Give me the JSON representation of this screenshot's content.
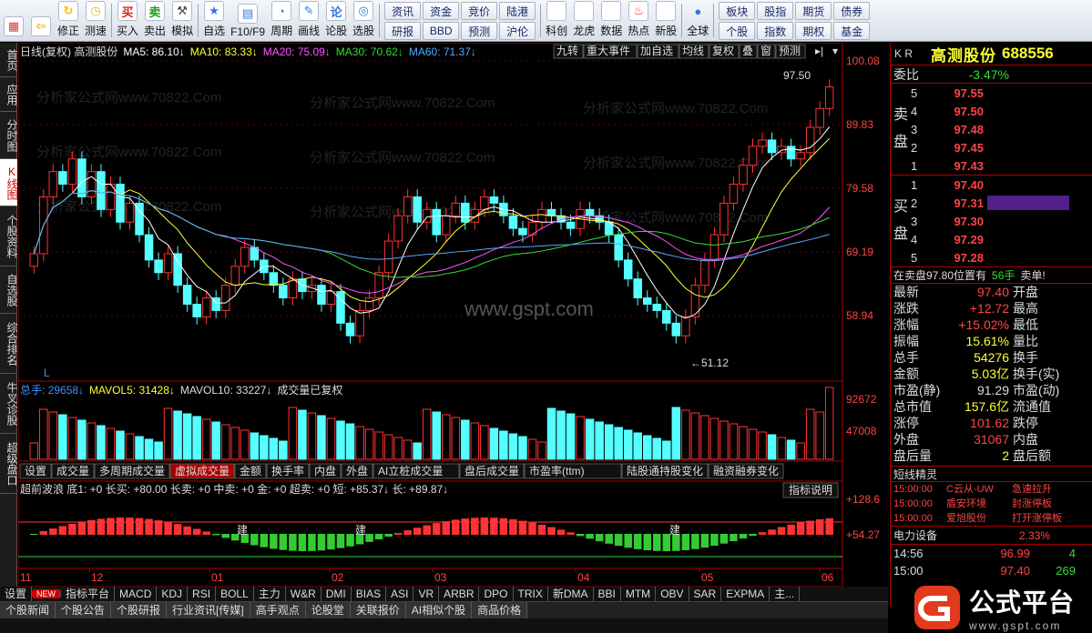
{
  "toolbar": {
    "left": [
      {
        "icon": "grid-icon",
        "label": ""
      },
      {
        "icon": "back-arrow-icon",
        "label": ""
      },
      {
        "icon": "repair-icon",
        "label": "修正"
      },
      {
        "icon": "speed-test-icon",
        "label": "测速"
      }
    ],
    "trade": [
      {
        "icon": "buy-icon",
        "label": "买入",
        "glyph": "买"
      },
      {
        "icon": "sell-icon",
        "label": "卖出",
        "glyph": "卖"
      },
      {
        "icon": "simulate-icon",
        "label": "模拟",
        "glyph": "⚒"
      }
    ],
    "tools": [
      {
        "icon": "star-icon",
        "label": "自选"
      },
      {
        "icon": "f10-icon",
        "label": "F10/F9"
      },
      {
        "icon": "period-icon",
        "label": "周期"
      },
      {
        "icon": "draw-icon",
        "label": "画线"
      },
      {
        "icon": "stock-forum-icon",
        "label": "论股"
      },
      {
        "icon": "stock-picker-icon",
        "label": "选股"
      }
    ],
    "grid1": [
      [
        "资讯",
        "研报"
      ],
      [
        "资金",
        "BBD"
      ],
      [
        "竞价",
        "预测"
      ],
      [
        "陆港",
        "沪伦"
      ]
    ],
    "tools2": [
      {
        "icon": "science-board-icon",
        "label": "科创"
      },
      {
        "icon": "dragon-tiger-icon",
        "label": "龙虎"
      },
      {
        "icon": "data-icon",
        "label": "数据"
      },
      {
        "icon": "hot-icon",
        "label": "热点"
      },
      {
        "icon": "ipo-icon",
        "label": "新股"
      }
    ],
    "globe": {
      "icon": "globe-icon",
      "label": "全球"
    },
    "grid2": [
      [
        "板块",
        "个股"
      ],
      [
        "股指",
        "指数"
      ],
      [
        "期货",
        "期权"
      ],
      [
        "债券",
        "基金"
      ]
    ]
  },
  "sidetabs": [
    {
      "label": "首页",
      "active": false
    },
    {
      "label": "应用",
      "active": false
    },
    {
      "label": "分时图",
      "active": false
    },
    {
      "label": "K线图",
      "active": true
    },
    {
      "label": "个股资料",
      "active": false
    },
    {
      "label": "自选股",
      "active": false
    },
    {
      "label": "综合排名",
      "active": false
    },
    {
      "label": "牛叉诊股",
      "active": false
    },
    {
      "label": "超级盘口",
      "active": false
    }
  ],
  "chart": {
    "header": "日线(复权) 高测股份",
    "ma": [
      {
        "label": "MA5: 86.10↓",
        "color": "#ffffff"
      },
      {
        "label": "MA10: 83.33↓",
        "color": "#ffff33"
      },
      {
        "label": "MA20: 75.09↓",
        "color": "#ff55ff"
      },
      {
        "label": "MA30: 70.62↓",
        "color": "#33dd33"
      },
      {
        "label": "MA60: 71.37↓",
        "color": "#55aaff"
      }
    ],
    "buttons": [
      "九转",
      "重大事件",
      "加自选",
      "均线",
      "复权",
      "叠",
      "窗",
      "预测"
    ],
    "price_ticks": [
      "100.08",
      "89.83",
      "79.58",
      "69.19",
      "58.94"
    ],
    "high_label": "97.50",
    "low_label": "51.12",
    "watermark": "分析家公式网www.70822.Com",
    "site": "www.gspt.com",
    "vol_header": {
      "a": "总手: 29658↓",
      "b": "MAVOL5: 31428↓",
      "c": "MAVOL10: 33227↓",
      "d": "成交量已复权"
    },
    "vol_ticks": [
      "92672",
      "47008"
    ],
    "vol_tabs": [
      "设置",
      "成交量",
      "多周期成交量",
      "虚拟成交量",
      "金额",
      "换手率",
      "内盘",
      "外盘",
      "AI立桩成交量",
      "盘后成交量",
      "市盈率(ttm)",
      "陆股通持股变化",
      "融资融券变化"
    ],
    "vol_active": "虚拟成交量",
    "ind_header": "超前波浪 底1: +0 长买: +80.00 长卖: +0 中卖: +0 金: +0 超卖: +0 短: +85.37↓ 长: +89.87↓",
    "ind_btn": "指标说明",
    "ind_ticks": [
      "+128.6",
      "+54.27"
    ],
    "ind_marks": [
      "建",
      "建",
      "建"
    ],
    "dates": [
      "11",
      "12",
      "01",
      "02",
      "03",
      "04",
      "05",
      "06"
    ],
    "L_label": "L"
  },
  "chart_data": {
    "type": "candlestick",
    "stock": "高测股份 688556",
    "ylim": [
      51.12,
      100.08
    ],
    "closes": [
      71,
      80,
      84,
      82,
      86,
      80,
      84,
      78,
      82,
      76,
      79,
      74,
      70,
      68,
      71,
      66,
      63,
      61,
      64,
      62,
      66,
      69,
      72,
      70,
      68,
      66,
      64,
      67,
      65,
      66,
      63,
      65,
      60,
      58,
      62,
      64,
      68,
      73,
      77,
      80,
      76,
      78,
      74,
      77,
      79,
      76,
      78,
      80,
      79,
      77,
      75,
      74,
      76,
      78,
      77,
      76,
      75,
      78,
      77,
      76,
      74,
      70,
      67,
      64,
      63,
      62,
      60,
      58,
      61,
      66,
      70,
      74,
      79,
      82,
      85,
      88,
      89,
      87,
      88,
      86,
      87,
      91,
      94,
      97.4
    ],
    "vol_ylim": [
      0,
      92672
    ]
  },
  "orderbook": {
    "title": {
      "kr": "K R",
      "name": "高测股份",
      "code": "688556"
    },
    "weibi": {
      "label": "委比",
      "value": "-3.47%"
    },
    "sell_label": "卖盘",
    "buy_label": "买盘",
    "sells": [
      {
        "l": "5",
        "p": "97.55"
      },
      {
        "l": "4",
        "p": "97.50"
      },
      {
        "l": "3",
        "p": "97.48"
      },
      {
        "l": "2",
        "p": "97.45"
      },
      {
        "l": "1",
        "p": "97.43"
      }
    ],
    "buys": [
      {
        "l": "1",
        "p": "97.40"
      },
      {
        "l": "2",
        "p": "97.31"
      },
      {
        "l": "3",
        "p": "97.30"
      },
      {
        "l": "4",
        "p": "97.29"
      },
      {
        "l": "5",
        "p": "97.28"
      }
    ],
    "pending": "在卖盘97.80位置有",
    "pending_vol": "56手",
    "pending_tail": "卖单!",
    "stats": [
      {
        "k": "最新",
        "v": "97.40",
        "k2": "开盘"
      },
      {
        "k": "涨跌",
        "v": "+12.72",
        "k2": "最高"
      },
      {
        "k": "涨幅",
        "v": "+15.02%",
        "k2": "最低"
      },
      {
        "k": "振幅",
        "v": "15.61%",
        "k2": "量比"
      },
      {
        "k": "总手",
        "v": "54276",
        "k2": "换手"
      },
      {
        "k": "金额",
        "v": "5.03亿",
        "k2": "换手(实)"
      },
      {
        "k": "市盈(静)",
        "v": "91.29",
        "k2": "市盈(动)"
      },
      {
        "k": "总市值",
        "v": "157.6亿",
        "k2": "流通值"
      },
      {
        "k": "涨停",
        "v": "101.62",
        "k2": "跌停"
      },
      {
        "k": "外盘",
        "v": "31067",
        "k2": "内盘"
      },
      {
        "k": "盘后量",
        "v": "2",
        "k2": "盘后额"
      }
    ],
    "stat_colors": [
      "#f44",
      "#f44",
      "#f44",
      "#ff3",
      "#ff3",
      "#ff3",
      "#ddd",
      "#ff3",
      "#f44",
      "#f44",
      "#ff3"
    ],
    "news_title": "短线精灵",
    "news": [
      {
        "t": "15:00:00",
        "s": "C云从-UW",
        "e": "急速拉升"
      },
      {
        "t": "15:00:00",
        "s": "盾安环境",
        "e": "封涨停板"
      },
      {
        "t": "15:00:00",
        "s": "爱旭股份",
        "e": "打开涨停板"
      }
    ],
    "sector": {
      "name": "电力设备",
      "pct": "2.33%"
    },
    "ticks": [
      {
        "t": "14:56",
        "p": "96.99",
        "v": "4"
      },
      {
        "t": "15:00",
        "p": "97.40",
        "v": "269"
      }
    ]
  },
  "bottom": {
    "row1": [
      "设置",
      "NEW",
      "指标平台",
      "MACD",
      "KDJ",
      "RSI",
      "BOLL",
      "主力",
      "W&R",
      "DMI",
      "BIAS",
      "ASI",
      "VR",
      "ARBR",
      "DPO",
      "TRIX",
      "新DMA",
      "BBI",
      "MTM",
      "OBV",
      "SAR",
      "EXPMA",
      "主..."
    ],
    "row2": [
      "个股新闻",
      "个股公告",
      "个股研报",
      "行业资讯[传媒]",
      "高手观点",
      "论股堂",
      "关联报价",
      "AI相似个股",
      "商品价格"
    ]
  },
  "logo": {
    "text": "公式平台",
    "url": "www.gspt.com"
  }
}
